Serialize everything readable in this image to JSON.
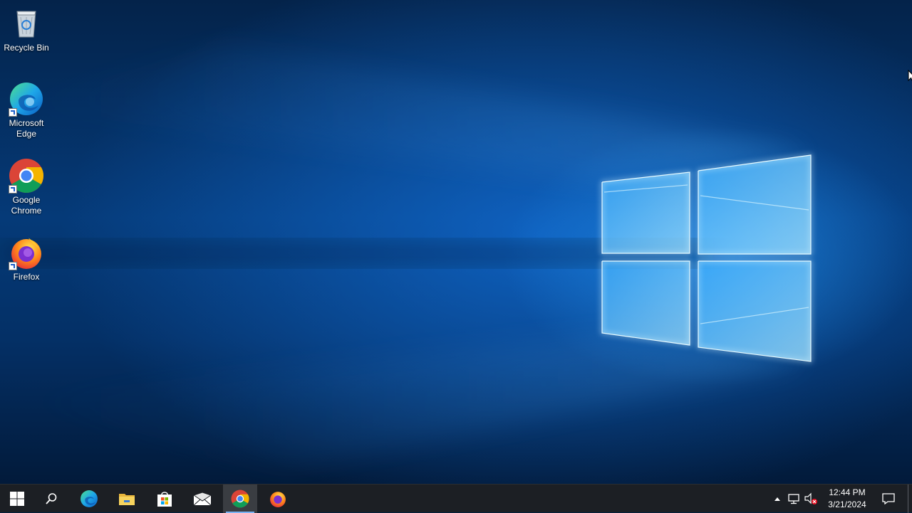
{
  "desktop": {
    "icons": [
      {
        "label": "Recycle Bin",
        "icon": "recycle-bin-icon"
      },
      {
        "label": "Microsoft Edge",
        "icon": "edge-icon"
      },
      {
        "label": "Google Chrome",
        "icon": "chrome-icon"
      },
      {
        "label": "Firefox",
        "icon": "firefox-icon"
      }
    ]
  },
  "taskbar": {
    "buttons": [
      {
        "icon": "windows-start-icon"
      },
      {
        "icon": "search-icon"
      },
      {
        "icon": "edge-icon"
      },
      {
        "icon": "file-explorer-icon"
      },
      {
        "icon": "microsoft-store-icon"
      },
      {
        "icon": "mail-icon"
      },
      {
        "icon": "chrome-icon",
        "state": "active"
      },
      {
        "icon": "firefox-icon"
      }
    ],
    "tray": {
      "time": "12:44 PM",
      "date": "3/21/2024"
    }
  },
  "colors": {
    "taskbar": "#1c1f24",
    "accent": "#7ab3f4",
    "wallpaper_glow": "#1e90ff"
  }
}
